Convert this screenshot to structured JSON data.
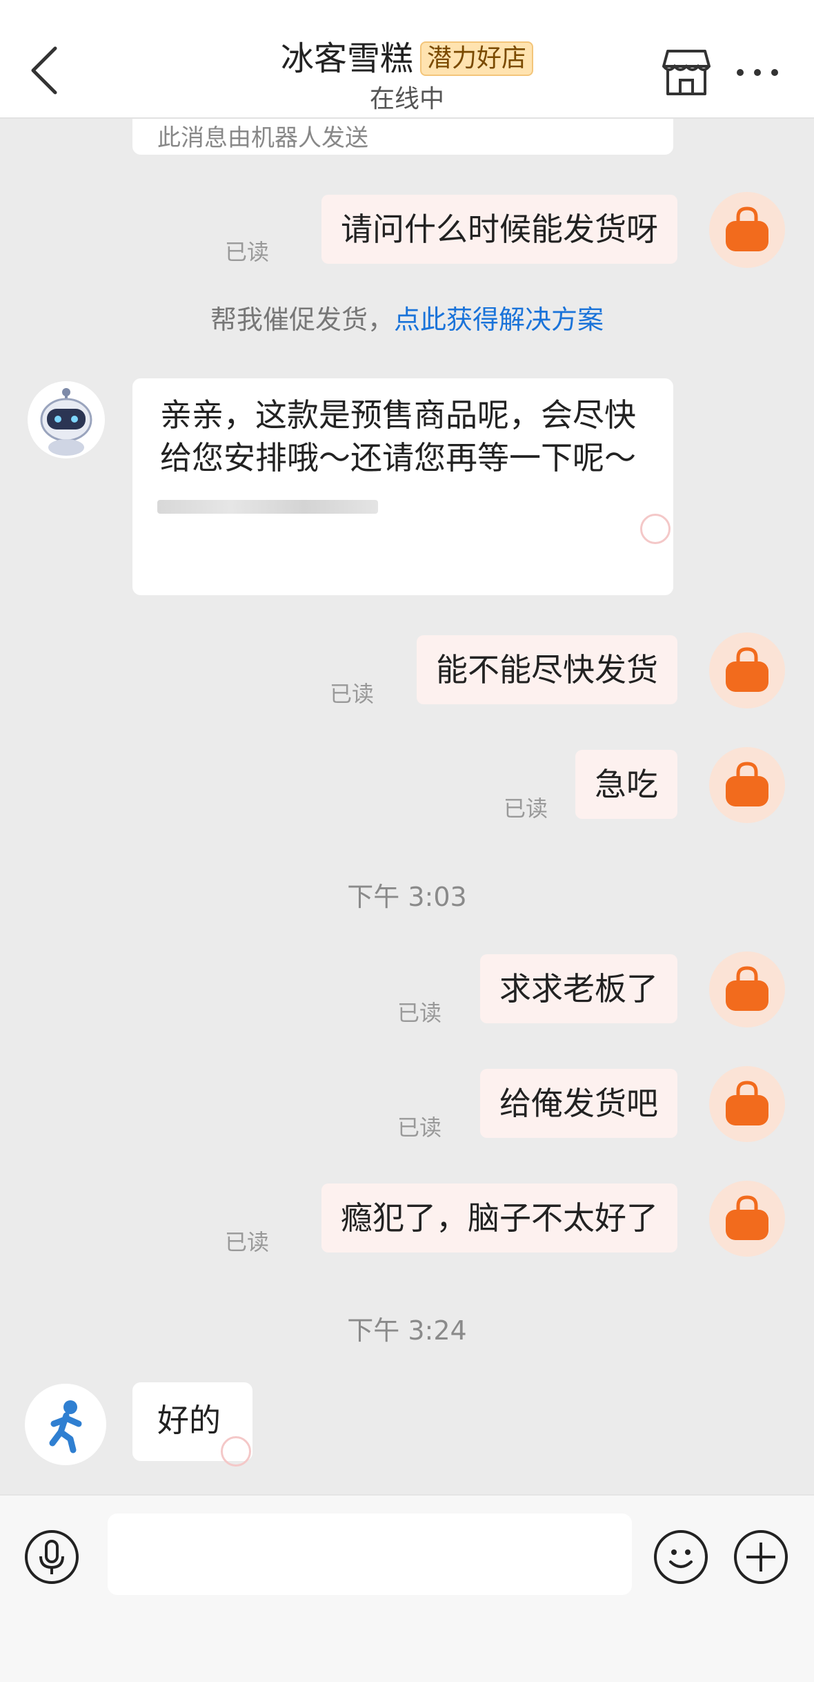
{
  "header": {
    "title": "冰客雪糕",
    "badge": "潜力好店",
    "status": "在线中"
  },
  "messages": {
    "robot_note": "此消息由机器人发送",
    "m1": {
      "text": "请问什么时候能发货呀",
      "status": "已读"
    },
    "hint_prefix": "帮我催促发货，",
    "hint_link": "点此获得解决方案",
    "bot_reply": "亲亲，这款是预售商品呢，会尽快给您安排哦～还请您再等一下呢～",
    "m2": {
      "text": "能不能尽快发货",
      "status": "已读"
    },
    "m3": {
      "text": "急吃",
      "status": "已读"
    },
    "time1": "下午 3:03",
    "m4": {
      "text": "求求老板了",
      "status": "已读"
    },
    "m5": {
      "text": "给俺发货吧",
      "status": "已读"
    },
    "m6": {
      "text": "瘾犯了，脑子不太好了",
      "status": "已读"
    },
    "time2": "下午 3:24",
    "seller_reply": "好的"
  },
  "colors": {
    "accent_orange": "#f26b1d",
    "link_blue": "#1a73d9",
    "badge_bg": "#ffe3b0"
  },
  "icons": [
    "back-icon",
    "shop-icon",
    "more-icon",
    "bag-icon",
    "robot-icon",
    "runner-icon",
    "voice-icon",
    "emoji-icon",
    "plus-icon"
  ]
}
